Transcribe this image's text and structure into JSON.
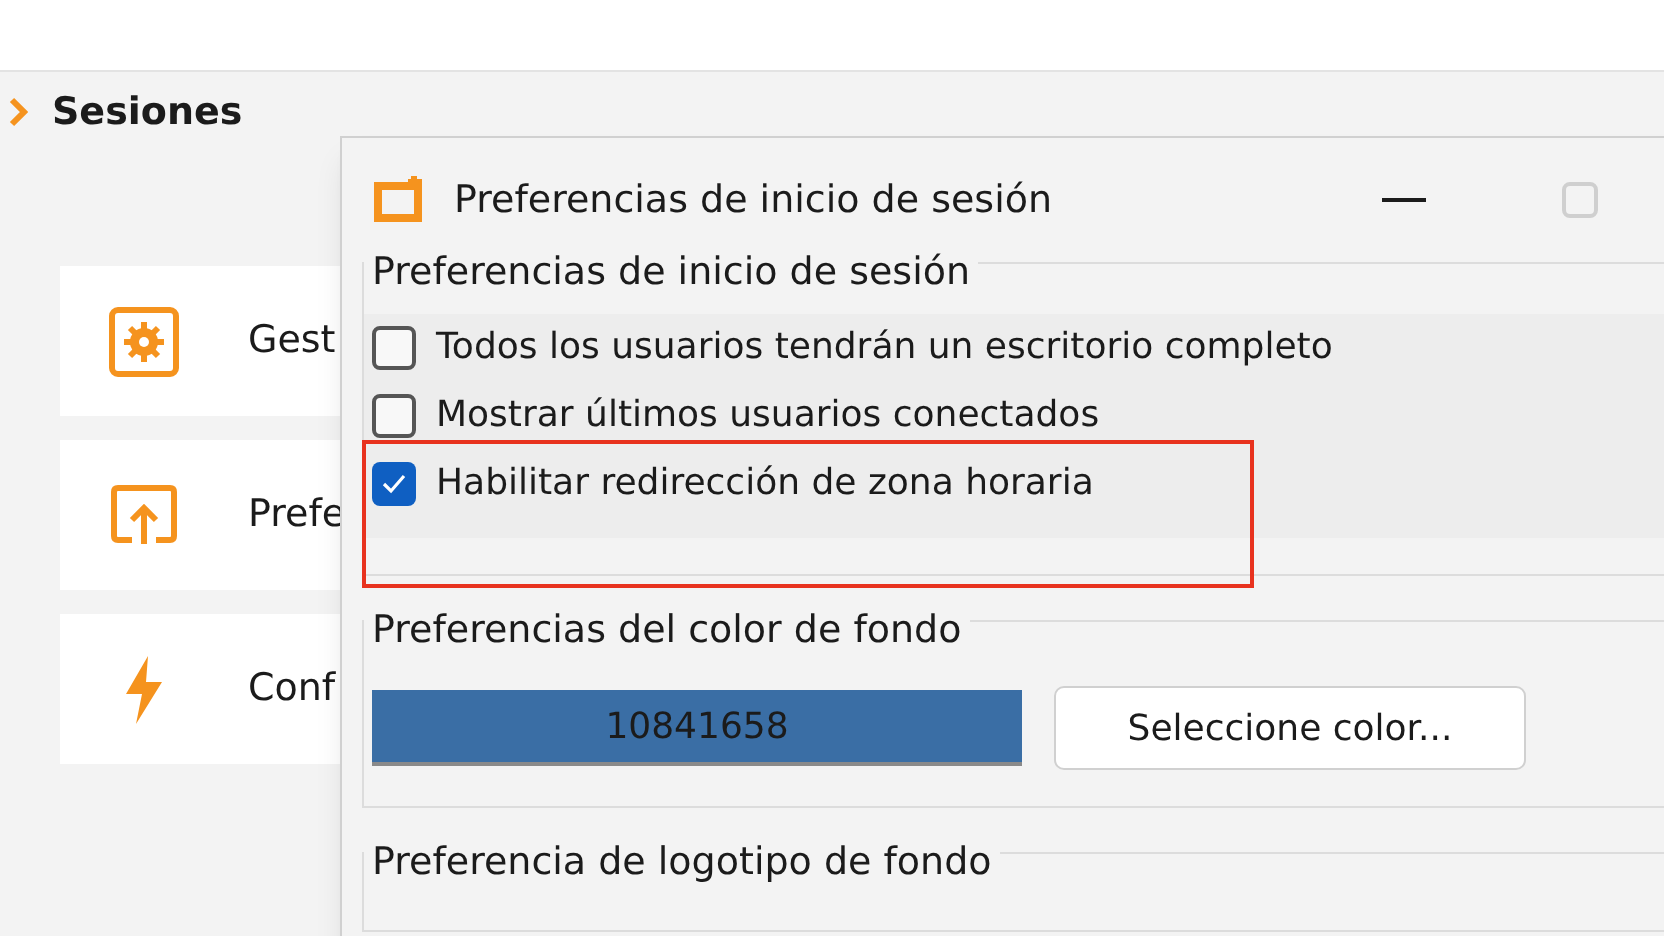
{
  "page": {
    "section_title": "Sesiones",
    "cards": [
      {
        "kind": "gear",
        "label": "Gest"
      },
      {
        "kind": "upload",
        "label": "Prefe"
      },
      {
        "kind": "bolt",
        "label": "Conf"
      }
    ]
  },
  "dialog": {
    "title": "Preferencias de inicio de sesión",
    "login_group": {
      "title": "Preferencias de inicio de sesión",
      "options": [
        {
          "label": "Todos los usuarios tendrán un escritorio completo",
          "checked": false
        },
        {
          "label": "Mostrar últimos usuarios conectados",
          "checked": false
        },
        {
          "label": "Habilitar redirección de zona horaria",
          "checked": true
        }
      ]
    },
    "color_group": {
      "title": "Preferencias del color de fondo",
      "color": "#3a6ea5",
      "value": "10841658",
      "button": "Seleccione color..."
    },
    "logo_group": {
      "title": "Preferencia de logotipo de fondo"
    }
  }
}
